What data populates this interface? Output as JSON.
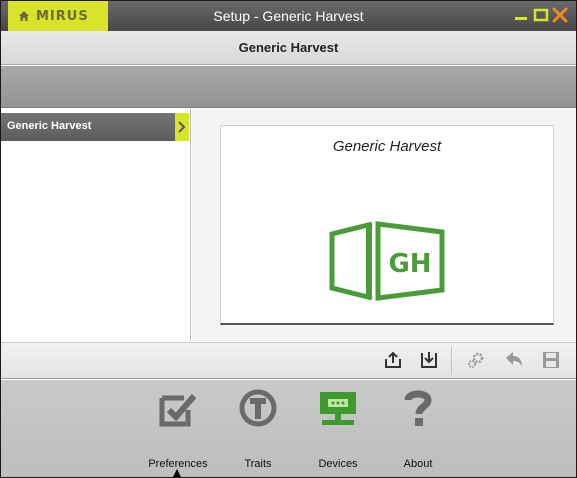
{
  "titlebar": {
    "logo_text": "MIRUS",
    "title": "Setup - Generic Harvest"
  },
  "header": {
    "title": "Generic Harvest"
  },
  "sidebar": {
    "items": [
      {
        "label": "Generic Harvest",
        "selected": true
      }
    ]
  },
  "preview": {
    "title": "Generic Harvest",
    "logo_text": "GH"
  },
  "toolbar": {
    "icons": [
      "export-icon",
      "import-icon",
      "settings-icon",
      "undo-icon",
      "save-icon"
    ]
  },
  "bottom_nav": {
    "items": [
      {
        "label": "Preferences",
        "icon": "preferences-icon"
      },
      {
        "label": "Traits",
        "icon": "traits-icon"
      },
      {
        "label": "Devices",
        "icon": "devices-icon"
      },
      {
        "label": "About",
        "icon": "about-icon"
      }
    ]
  },
  "colors": {
    "accent": "#d8e32a",
    "brand_green": "#4a9c3a",
    "devices_green": "#3f9a2e"
  }
}
